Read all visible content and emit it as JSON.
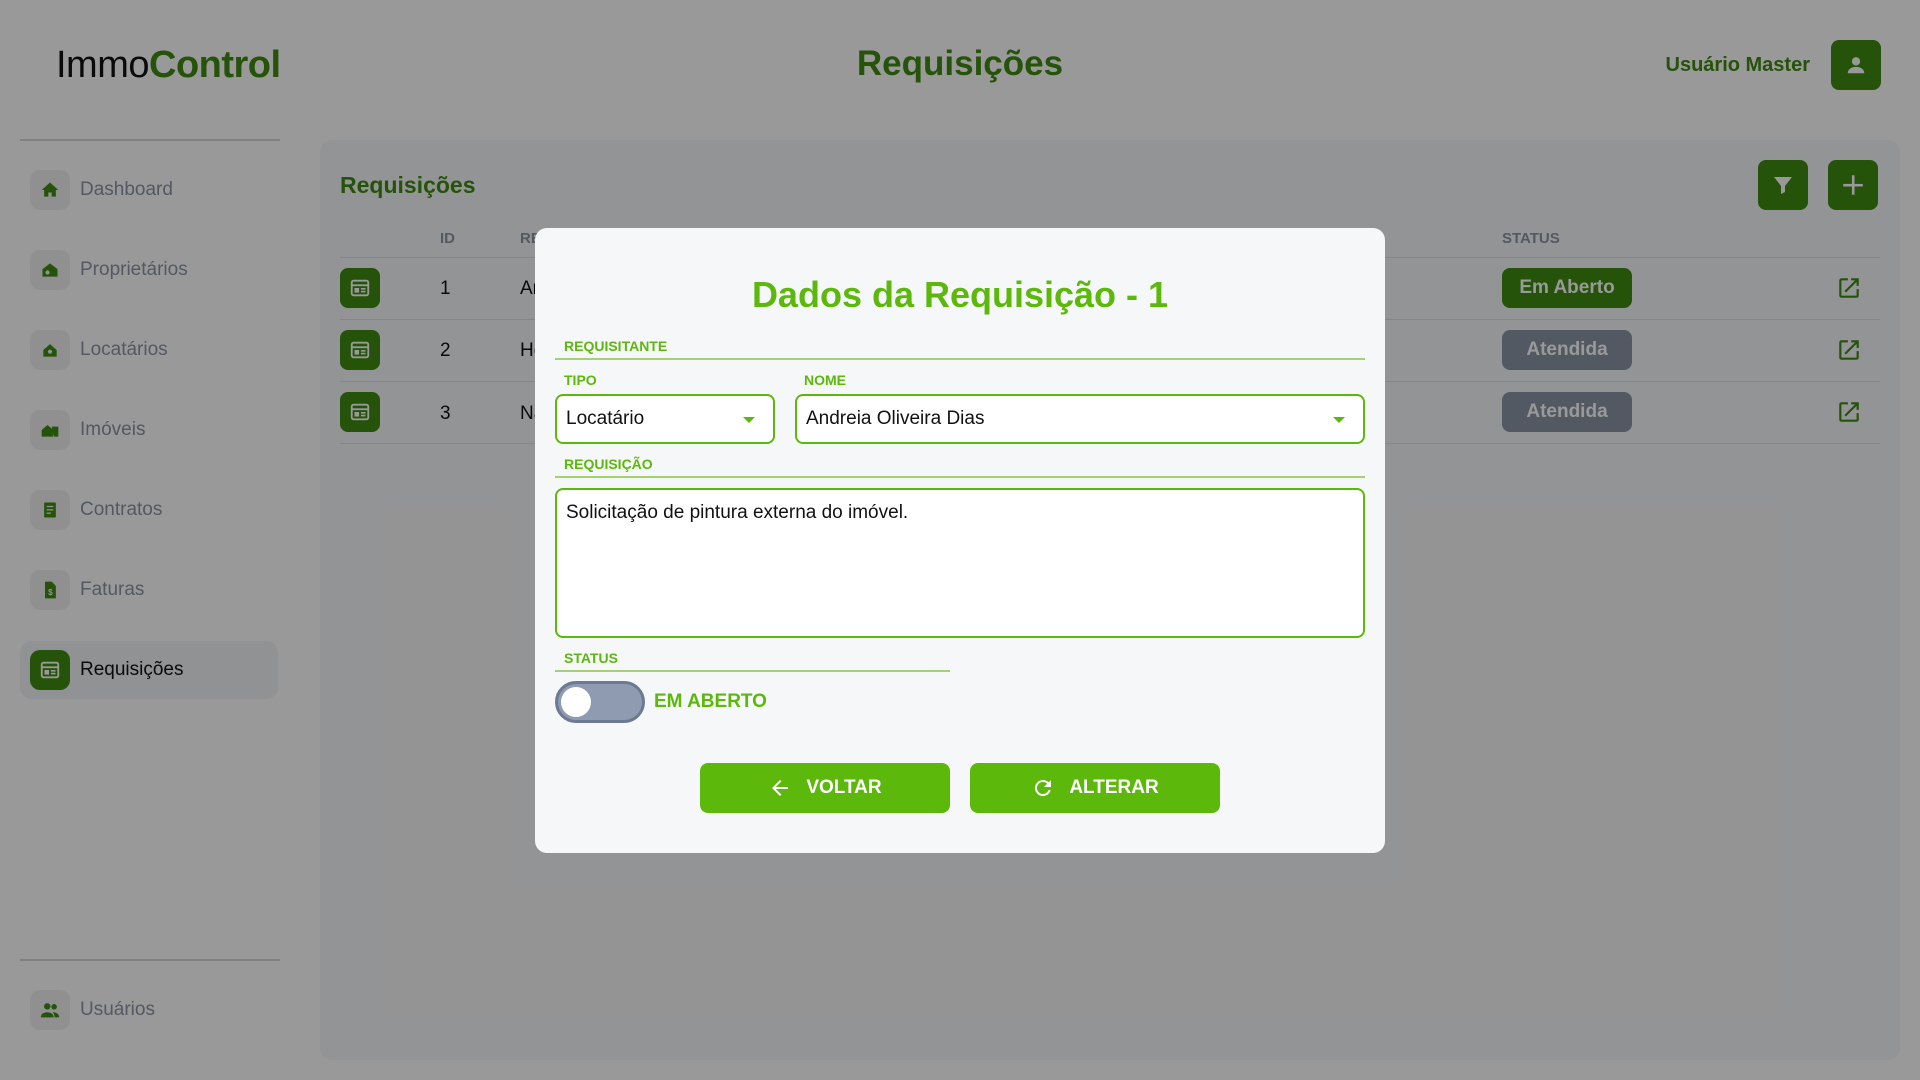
{
  "app": {
    "logo_part1": "Immo",
    "logo_part2": "Control",
    "page_title": "Requisições",
    "user_name": "Usuário Master"
  },
  "sidebar": {
    "items": [
      {
        "label": "Dashboard",
        "icon": "home-icon"
      },
      {
        "label": "Proprietários",
        "icon": "owner-icon"
      },
      {
        "label": "Locatários",
        "icon": "tenant-icon"
      },
      {
        "label": "Imóveis",
        "icon": "property-icon"
      },
      {
        "label": "Contratos",
        "icon": "contract-icon"
      },
      {
        "label": "Faturas",
        "icon": "invoice-icon"
      },
      {
        "label": "Requisições",
        "icon": "requests-icon",
        "active": true
      }
    ],
    "footer_item": {
      "label": "Usuários",
      "icon": "users-icon"
    }
  },
  "main": {
    "title": "Requisições",
    "columns": {
      "id": "ID",
      "requisicao": "RE",
      "status": "STATUS"
    },
    "rows": [
      {
        "id": "1",
        "requisicao": "Ar",
        "status": "Em Aberto"
      },
      {
        "id": "2",
        "requisicao": "He",
        "status": "Atendida"
      },
      {
        "id": "3",
        "requisicao": "Na",
        "status": "Atendida"
      }
    ]
  },
  "modal": {
    "title": "Dados da Requisição - 1",
    "section_requisitante": "REQUISITANTE",
    "tipo_label": "TIPO",
    "tipo_value": "Locatário",
    "nome_label": "NOME",
    "nome_value": "Andreia Oliveira Dias",
    "section_requisicao": "REQUISIÇÃO",
    "requisicao_text": "Solicitação de pintura externa do imóvel.",
    "section_status": "STATUS",
    "status_toggle_label": "EM ABERTO",
    "back_label": "VOLTAR",
    "update_label": "ALTERAR"
  },
  "colors": {
    "brand_dark": "#3f8a0f",
    "brand_light": "#5cb80a",
    "muted": "#8a94a3"
  }
}
